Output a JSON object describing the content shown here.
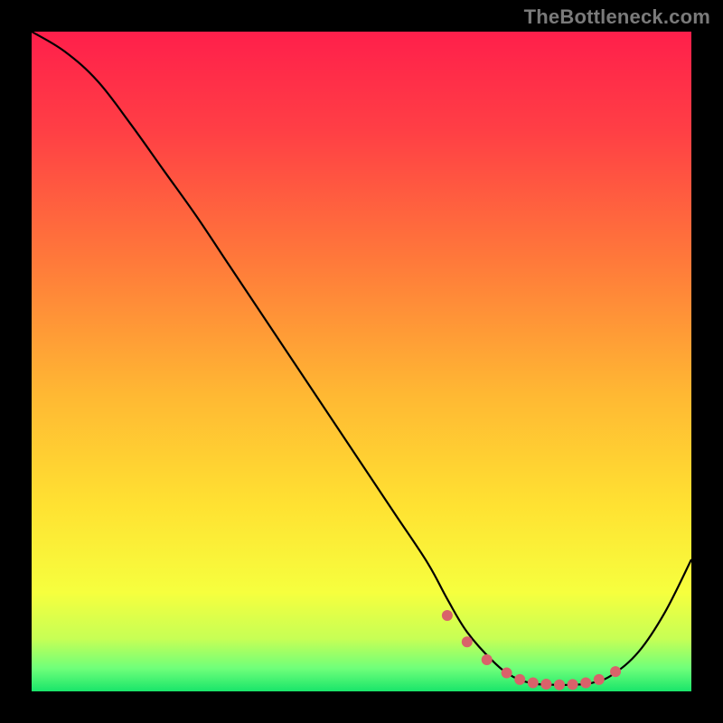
{
  "attribution": "TheBottleneck.com",
  "chart_data": {
    "type": "line",
    "title": "",
    "xlabel": "",
    "ylabel": "",
    "xlim": [
      0,
      100
    ],
    "ylim": [
      0,
      100
    ],
    "grid": false,
    "legend": false,
    "gradient_stops": [
      {
        "offset": 0.0,
        "color": "#ff1f4b"
      },
      {
        "offset": 0.15,
        "color": "#ff3f45"
      },
      {
        "offset": 0.35,
        "color": "#ff7a3a"
      },
      {
        "offset": 0.55,
        "color": "#ffb833"
      },
      {
        "offset": 0.72,
        "color": "#ffe232"
      },
      {
        "offset": 0.85,
        "color": "#f6ff3e"
      },
      {
        "offset": 0.92,
        "color": "#c7ff55"
      },
      {
        "offset": 0.965,
        "color": "#6fff7a"
      },
      {
        "offset": 1.0,
        "color": "#19e56a"
      }
    ],
    "series": [
      {
        "name": "bottleneck-curve",
        "color": "#000000",
        "x": [
          0,
          5,
          10,
          15,
          20,
          25,
          30,
          35,
          40,
          45,
          50,
          55,
          60,
          63,
          66,
          70,
          73,
          76,
          79,
          82,
          85,
          88,
          92,
          96,
          100
        ],
        "y": [
          100,
          97,
          92.5,
          86,
          79,
          72,
          64.5,
          57,
          49.5,
          42,
          34.5,
          27,
          19.5,
          14,
          9,
          4.5,
          2.2,
          1.2,
          1.0,
          1.0,
          1.3,
          2.5,
          6,
          12,
          20
        ]
      }
    ],
    "valley_markers": {
      "color": "#d9626a",
      "radius": 6,
      "x": [
        63,
        66,
        69,
        72,
        74,
        76,
        78,
        80,
        82,
        84,
        86,
        88.5
      ],
      "y": [
        11.5,
        7.5,
        4.8,
        2.8,
        1.8,
        1.3,
        1.1,
        1.0,
        1.05,
        1.3,
        1.8,
        3.0
      ]
    }
  }
}
